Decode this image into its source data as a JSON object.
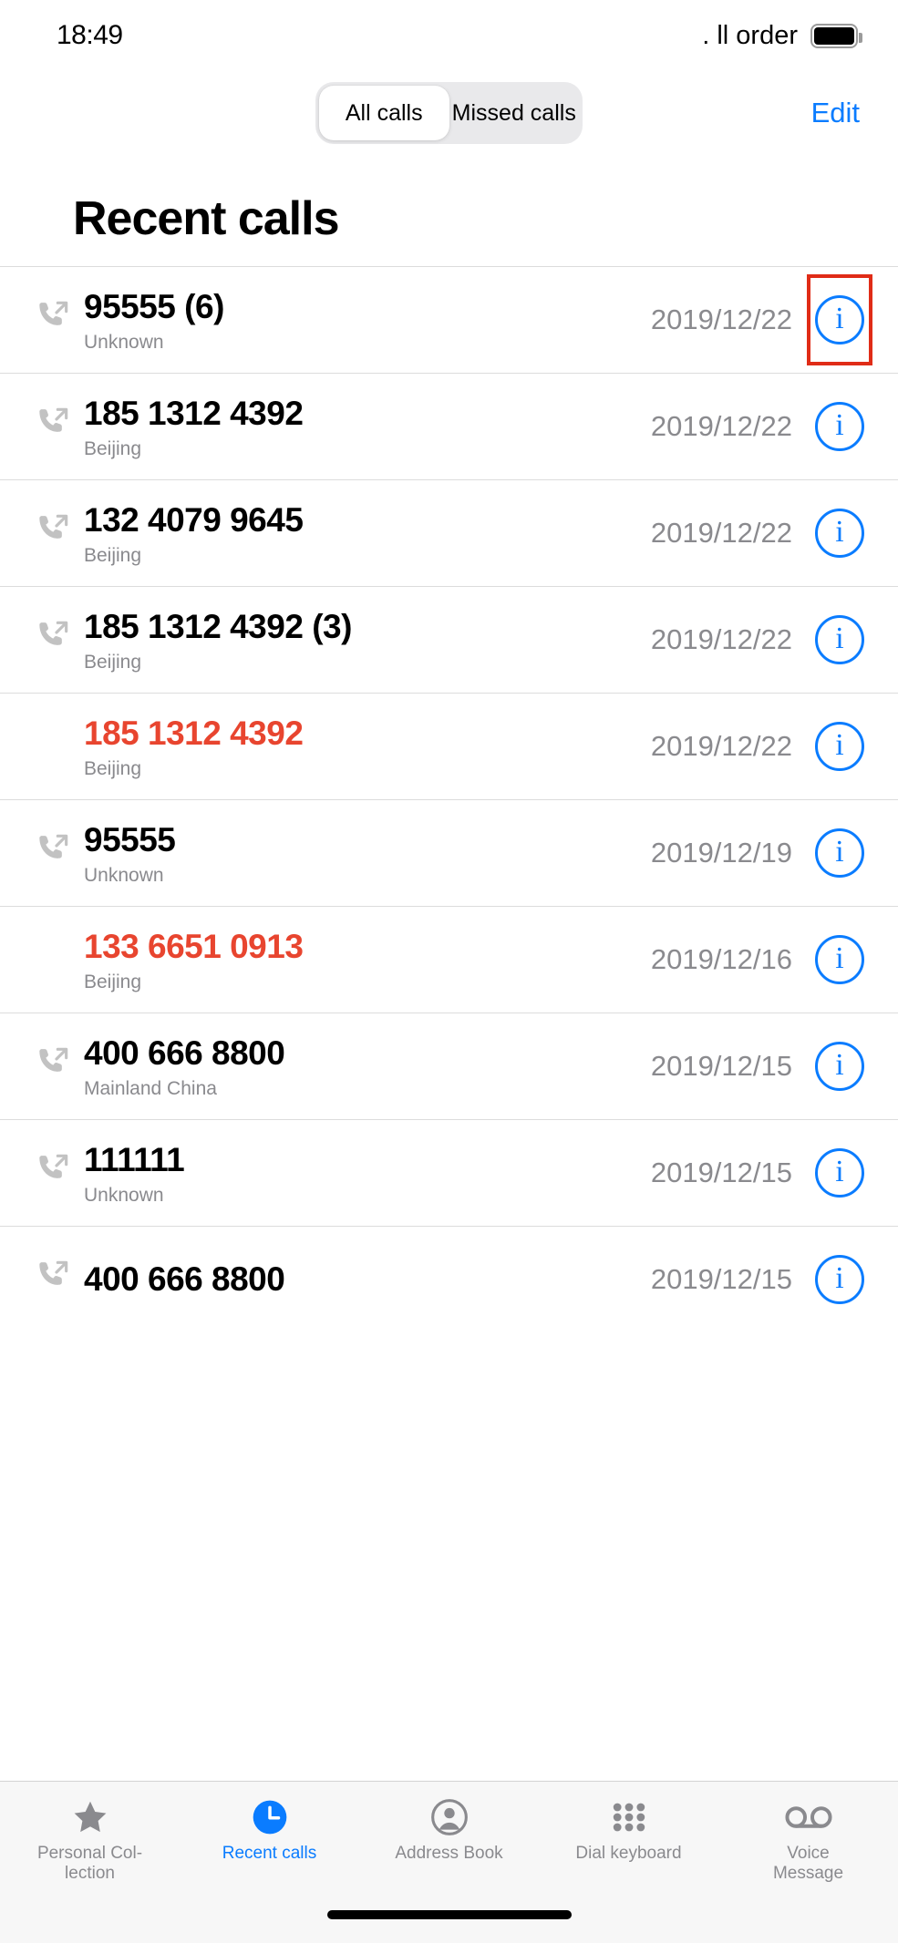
{
  "status_bar": {
    "time": "18:49",
    "carrier": ". ll order",
    "battery_icon": "battery-full-icon"
  },
  "top_bar": {
    "segments": [
      {
        "label": "All calls",
        "selected": true
      },
      {
        "label": "Missed calls",
        "selected": false
      }
    ],
    "edit_label": "Edit",
    "accent_color": "#0a7cff"
  },
  "page": {
    "title": "Recent calls"
  },
  "colors": {
    "accent": "#0a7cff",
    "missed": "#e8452f",
    "highlight_box": "#e02c17",
    "secondary_text": "#8a8a8e"
  },
  "calls": [
    {
      "number": "95555 (6)",
      "location": "Unknown",
      "date": "2019/12/22",
      "missed": false,
      "icon": "outgoing-call-icon",
      "highlighted": true
    },
    {
      "number": "185 1312 4392",
      "location": "Beijing",
      "date": "2019/12/22",
      "missed": false,
      "icon": "outgoing-call-icon",
      "highlighted": false
    },
    {
      "number": "132 4079 9645",
      "location": "Beijing",
      "date": "2019/12/22",
      "missed": false,
      "icon": "outgoing-call-icon",
      "highlighted": false
    },
    {
      "number": "185 1312 4392 (3)",
      "location": "Beijing",
      "date": "2019/12/22",
      "missed": false,
      "icon": "outgoing-call-icon",
      "highlighted": false
    },
    {
      "number": "185 1312 4392",
      "location": "Beijing",
      "date": "2019/12/22",
      "missed": true,
      "icon": "none",
      "highlighted": false
    },
    {
      "number": "95555",
      "location": "Unknown",
      "date": "2019/12/19",
      "missed": false,
      "icon": "outgoing-call-icon",
      "highlighted": false
    },
    {
      "number": "133 6651 0913",
      "location": "Beijing",
      "date": "2019/12/16",
      "missed": true,
      "icon": "none",
      "highlighted": false
    },
    {
      "number": "400 666 8800",
      "location": "Mainland China",
      "date": "2019/12/15",
      "missed": false,
      "icon": "outgoing-call-icon",
      "highlighted": false
    },
    {
      "number": "111111",
      "location": "Unknown",
      "date": "2019/12/15",
      "missed": false,
      "icon": "outgoing-call-icon",
      "highlighted": false
    },
    {
      "number": "400 666 8800",
      "location": "",
      "date": "2019/12/15",
      "missed": false,
      "icon": "outgoing-call-icon",
      "highlighted": false
    }
  ],
  "info_button_label": "i",
  "tab_bar": {
    "items": [
      {
        "label": "Personal Col-lection",
        "icon": "star-icon",
        "active": false
      },
      {
        "label": "Recent calls",
        "icon": "clock-icon",
        "active": true
      },
      {
        "label": "Address Book",
        "icon": "person-icon",
        "active": false
      },
      {
        "label": "Dial keyboard",
        "icon": "keypad-dots-icon",
        "active": false
      },
      {
        "label": "Voice Message",
        "icon": "voicemail-icon",
        "active": false
      }
    ]
  }
}
